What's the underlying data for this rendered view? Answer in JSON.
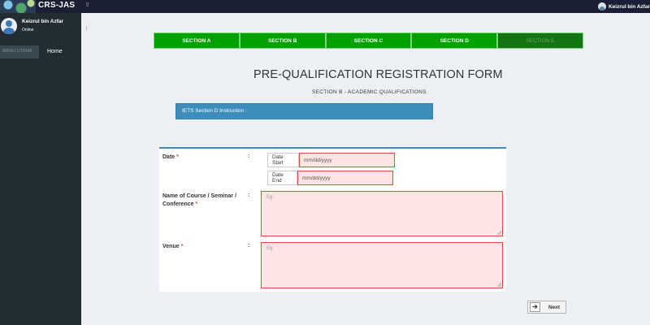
{
  "app": {
    "title": "CRS-JAS",
    "toggle_icon": "menu-icon"
  },
  "top_user": {
    "name": "Keizrul bin Azfar"
  },
  "sidebar": {
    "user_name": "Keizrul bin Azfar",
    "user_status": "Online",
    "search_placeholder": "MENU UTAMA",
    "home_label": "Home"
  },
  "breadcrumb_mark": "|",
  "tabs": [
    {
      "label": "SECTION A",
      "enabled": true
    },
    {
      "label": "SECTION B",
      "enabled": true
    },
    {
      "label": "SECTION C",
      "enabled": true
    },
    {
      "label": "SECTION D",
      "enabled": true
    },
    {
      "label": "SECTION E",
      "enabled": false
    }
  ],
  "form": {
    "title": "PRE-QUALIFICATION REGISTRATION FORM",
    "subtitle": "SECTION B - ACADEMIC QUALIFICATIONS",
    "instruction": "IETS Section D Instruction :"
  },
  "fields": {
    "date_label": "Date",
    "required_mark": "*",
    "colon": ":",
    "date_start_label": "Date Start",
    "date_start_placeholder": "mm/dd/yyyy",
    "date_end_label": "Date End",
    "date_end_placeholder": "mm/dd/yyyy",
    "course_label": "Name of Course / Seminar / Conference",
    "course_placeholder": "Eg:",
    "venue_label": "Venue",
    "venue_placeholder": "Eg:"
  },
  "next_button": {
    "label": "Next",
    "icon": "arrow-right-icon"
  },
  "colors": {
    "tab_green": "#00a100",
    "tab_disabled": "#127512",
    "instruction_blue": "#3c8dbc",
    "error_red": "#dd4b39",
    "input_error_bg": "#fde5e5"
  }
}
